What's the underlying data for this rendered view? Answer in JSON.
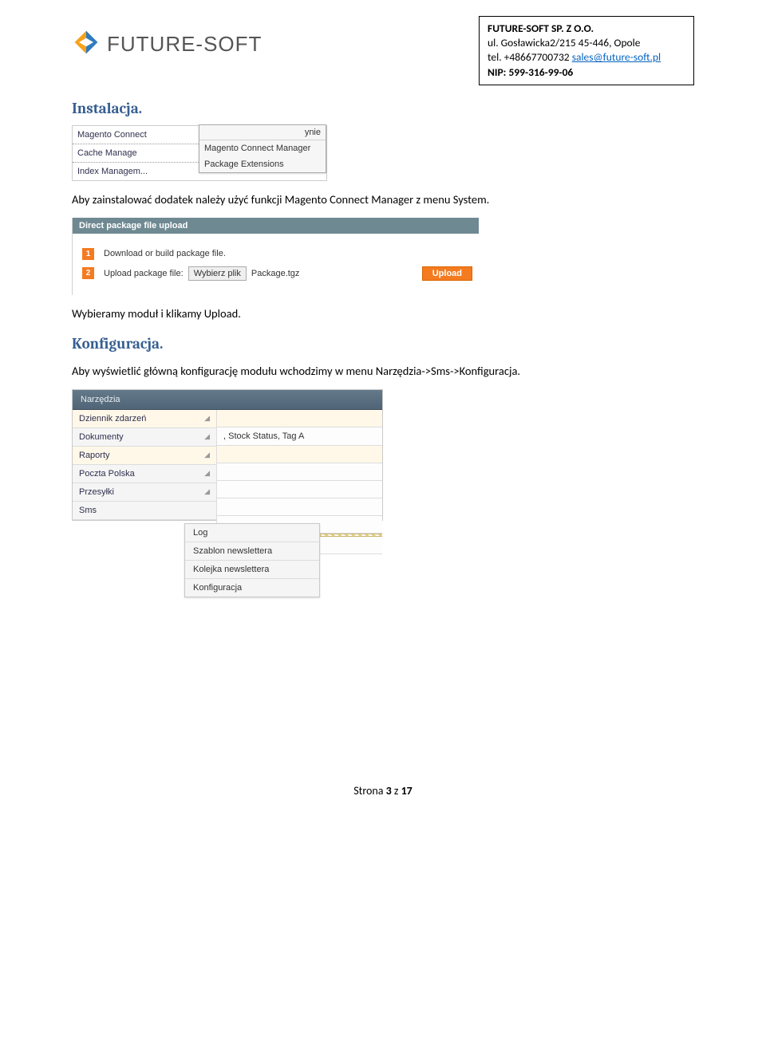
{
  "header": {
    "logo_text": "FUTURE-SOFT",
    "company": {
      "line1": "FUTURE-SOFT SP. Z O.O.",
      "line2": "ul. Gosławicka2/215 45-446, Opole",
      "line3_prefix": "tel. +48667700732 ",
      "email": "sales@future-soft.pl",
      "line4_label": "NIP: ",
      "line4_value": "599-316-99-06"
    }
  },
  "sections": {
    "install_title": "Instalacja.",
    "install_text": "Aby zainstalować dodatek należy użyć funkcji Magento Connect Manager z menu System.",
    "upload_text": "Wybieramy moduł i klikamy Upload.",
    "config_title": "Konfiguracja.",
    "config_text": "Aby wyświetlić główną konfigurację modułu wchodzimy w menu Narzędzia->Sms->Konfiguracja."
  },
  "fig1": {
    "left": [
      "Magento Connect",
      "Cache Manage",
      "Index Managem..."
    ],
    "fly_hdr": "ynie",
    "fly_items": [
      "Magento Connect Manager",
      "Package Extensions"
    ]
  },
  "fig2": {
    "title": "Direct package file upload",
    "step1_num": "1",
    "step1_text": "Download or build package file.",
    "step2_num": "2",
    "step2_label": "Upload package file:",
    "choose_btn": "Wybierz plik",
    "filename": "Package.tgz",
    "upload_btn": "Upload"
  },
  "fig3": {
    "top": "Narzędzia",
    "left": [
      "Dziennik zdarzeń",
      "Dokumenty",
      "Raporty",
      "Poczta Polska",
      "Przesyłki",
      "Sms"
    ],
    "right_text": ", Stock Status, Tag A",
    "fly": [
      "Log",
      "Szablon newslettera",
      "Kolejka newslettera",
      "Konfiguracja"
    ]
  },
  "footer": {
    "prefix": "Strona ",
    "page": "3",
    "mid": " z ",
    "total": "17"
  }
}
